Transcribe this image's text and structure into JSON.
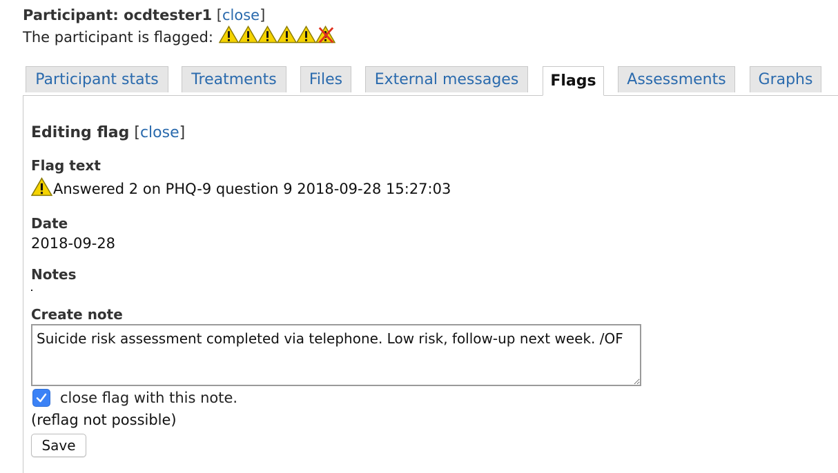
{
  "header": {
    "participant_label": "Participant: ocdtester1",
    "bracket_open": "[",
    "close_link": "close",
    "bracket_close": "]",
    "flag_status_text": "The participant is flagged:",
    "flag_icons": [
      "warning-icon",
      "warning-icon",
      "warning-icon",
      "warning-icon",
      "warning-icon",
      "warning-crossed-icon"
    ]
  },
  "tabs": [
    {
      "label": "Participant stats",
      "active": false
    },
    {
      "label": "Treatments",
      "active": false
    },
    {
      "label": "Files",
      "active": false
    },
    {
      "label": "External messages",
      "active": false
    },
    {
      "label": "Flags",
      "active": true
    },
    {
      "label": "Assessments",
      "active": false
    },
    {
      "label": "Graphs",
      "active": false
    }
  ],
  "panel": {
    "title": "Editing flag",
    "bracket_open": "[",
    "close_link": "close",
    "bracket_close": "]",
    "flag_text_label": "Flag text",
    "flag_text_value": "Answered 2 on PHQ-9 question 9 2018-09-28 15:27:03",
    "date_label": "Date",
    "date_value": "2018-09-28",
    "notes_label": "Notes",
    "create_note_label": "Create note",
    "note_value": "Suicide risk assessment completed via telephone. Low risk, follow-up next week. /OF",
    "close_flag_checked": true,
    "close_flag_label": "close flag with this note.",
    "reflag_text": "(reflag not possible)",
    "save_label": "Save"
  },
  "colors": {
    "link": "#2a6aad",
    "tab_background": "#e6e6e6",
    "checkbox_accent": "#3b82f6",
    "warning_yellow": "#f5d300"
  }
}
